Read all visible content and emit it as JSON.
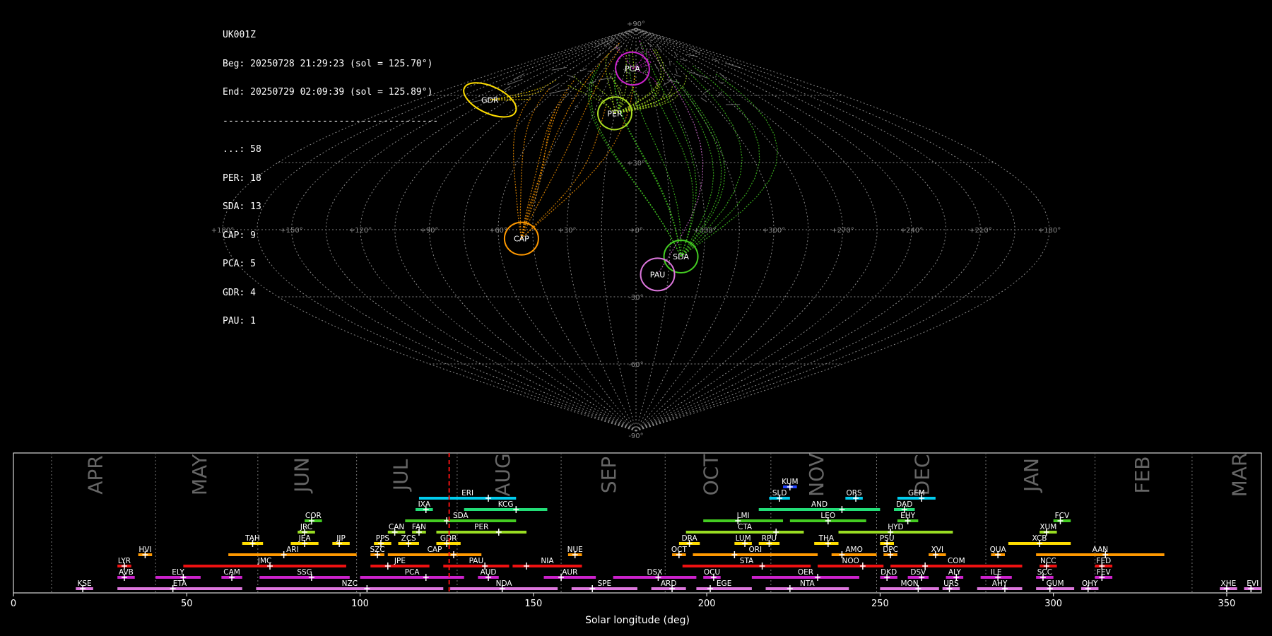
{
  "header": {
    "station": "UK001Z",
    "begin": "Beg: 20250728 21:29:23 (sol = 125.70°)",
    "end": "End: 20250729 02:09:39 (sol = 125.89°)",
    "separator": "---------------------------------------",
    "counts": [
      {
        "label": "...: 58"
      },
      {
        "label": "PER: 18"
      },
      {
        "label": "SDA: 13"
      },
      {
        "label": "CAP: 9"
      },
      {
        "label": "PCA: 5"
      },
      {
        "label": "GDR: 4"
      },
      {
        "label": "PAU: 1"
      }
    ]
  },
  "map": {
    "lon_ticks": [
      "+180°",
      "+150°",
      "+120°",
      "+90°",
      "+60°",
      "+30°",
      "+0°",
      "+330°",
      "+300°",
      "+270°",
      "+240°",
      "+210°",
      "+180°"
    ],
    "lat_ticks": [
      {
        "lat": 90,
        "label": "+90°"
      },
      {
        "lat": 30,
        "label": "+30°"
      },
      {
        "lat": -30,
        "label": "-30°"
      },
      {
        "lat": -60,
        "label": "-60°"
      },
      {
        "lat": -90,
        "label": "-90°"
      }
    ],
    "radiants": [
      {
        "code": "PCA",
        "x": -5,
        "y": 72,
        "color": "#cc22cc"
      },
      {
        "code": "PER",
        "x": -15,
        "y": 52,
        "color": "#aadd22"
      },
      {
        "code": "GDR",
        "x": -120,
        "y": 58,
        "color": "#ffdd00"
      },
      {
        "code": "CAP",
        "x": -50,
        "y": -4,
        "color": "#ff9900"
      },
      {
        "code": "SDA",
        "x": 20,
        "y": -12,
        "color": "#44cc22"
      },
      {
        "code": "PAU",
        "x": 10,
        "y": -20,
        "color": "#dd77dd"
      }
    ]
  },
  "chart_data": {
    "type": "timeline",
    "xlabel": "Solar longitude (deg)",
    "xlim": [
      0,
      360
    ],
    "xticks": [
      0,
      50,
      100,
      150,
      200,
      250,
      300,
      350
    ],
    "current_sol": 125.7,
    "months": [
      {
        "name": "APR",
        "start": 11,
        "label": 24
      },
      {
        "name": "MAY",
        "start": 41,
        "label": 54
      },
      {
        "name": "JUN",
        "start": 70.5,
        "label": 83.5
      },
      {
        "name": "JUL",
        "start": 99,
        "label": 112
      },
      {
        "name": "AUG",
        "start": 128,
        "label": 141.5
      },
      {
        "name": "SEP",
        "start": 158,
        "label": 172
      },
      {
        "name": "OCT",
        "start": 188,
        "label": 201.5
      },
      {
        "name": "NOV",
        "start": 218.5,
        "label": 232
      },
      {
        "name": "DEC",
        "start": 249,
        "label": 262.5
      },
      {
        "name": "JAN",
        "start": 280.5,
        "label": 294
      },
      {
        "name": "FEB",
        "start": 312,
        "label": 326
      },
      {
        "name": "MAR",
        "start": 340,
        "label": 354
      }
    ],
    "showers": [
      {
        "code": "KUM",
        "row": 10,
        "start": 222,
        "end": 226,
        "peak": 224,
        "color": "#2244ff"
      },
      {
        "code": "ERI",
        "row": 9,
        "start": 117,
        "end": 145,
        "peak": 137,
        "color": "#00ccee"
      },
      {
        "code": "SLD",
        "row": 9,
        "start": 218,
        "end": 224,
        "peak": 221,
        "color": "#00ccee"
      },
      {
        "code": "ORS",
        "row": 9,
        "start": 240,
        "end": 245,
        "peak": 243,
        "color": "#00ccee"
      },
      {
        "code": "GEM",
        "row": 9,
        "start": 255,
        "end": 266,
        "peak": 262,
        "color": "#00ccee"
      },
      {
        "code": "IXA",
        "row": 8,
        "start": 116,
        "end": 121,
        "peak": 119,
        "color": "#22dd77"
      },
      {
        "code": "KCG",
        "row": 8,
        "start": 130,
        "end": 154,
        "peak": 145,
        "color": "#22dd77"
      },
      {
        "code": "AND",
        "row": 8,
        "start": 215,
        "end": 250,
        "peak": 239,
        "color": "#22dd77"
      },
      {
        "code": "DAD",
        "row": 8,
        "start": 254,
        "end": 260,
        "peak": 257,
        "color": "#22dd77"
      },
      {
        "code": "COR",
        "row": 7,
        "start": 84,
        "end": 89,
        "peak": 86,
        "color": "#44cc22"
      },
      {
        "code": "SDA",
        "row": 7,
        "start": 113,
        "end": 145,
        "peak": 125,
        "color": "#44cc22"
      },
      {
        "code": "LMI",
        "row": 7,
        "start": 199,
        "end": 222,
        "peak": 209,
        "color": "#44cc22"
      },
      {
        "code": "LEO",
        "row": 7,
        "start": 224,
        "end": 246,
        "peak": 235,
        "color": "#44cc22"
      },
      {
        "code": "EHY",
        "row": 7,
        "start": 255,
        "end": 261,
        "peak": 258,
        "color": "#44cc22"
      },
      {
        "code": "FCV",
        "row": 7,
        "start": 300,
        "end": 305,
        "peak": 302,
        "color": "#44cc22"
      },
      {
        "code": "JRC",
        "row": 6,
        "start": 82,
        "end": 87,
        "peak": 84,
        "color": "#99dd22"
      },
      {
        "code": "CAN",
        "row": 6,
        "start": 108,
        "end": 113,
        "peak": 110,
        "color": "#99dd22"
      },
      {
        "code": "FAN",
        "row": 6,
        "start": 115,
        "end": 119,
        "peak": 117,
        "color": "#99dd22"
      },
      {
        "code": "PER",
        "row": 6,
        "start": 122,
        "end": 148,
        "peak": 140,
        "color": "#99dd22"
      },
      {
        "code": "CTA",
        "row": 6,
        "start": 194,
        "end": 228,
        "peak": 220,
        "color": "#99dd22"
      },
      {
        "code": "HYD",
        "row": 6,
        "start": 238,
        "end": 271,
        "peak": 253,
        "color": "#99dd22"
      },
      {
        "code": "XUM",
        "row": 6,
        "start": 296,
        "end": 301,
        "peak": 298,
        "color": "#99dd22"
      },
      {
        "code": "TAH",
        "row": 5,
        "start": 66,
        "end": 72,
        "peak": 69,
        "color": "#ffdd00"
      },
      {
        "code": "JEA",
        "row": 5,
        "start": 80,
        "end": 88,
        "peak": 84,
        "color": "#ffdd00"
      },
      {
        "code": "JIP",
        "row": 5,
        "start": 92,
        "end": 97,
        "peak": 94,
        "color": "#ffdd00"
      },
      {
        "code": "PPS",
        "row": 5,
        "start": 104,
        "end": 109,
        "peak": 106,
        "color": "#ffdd00"
      },
      {
        "code": "ZCS",
        "row": 5,
        "start": 111,
        "end": 117,
        "peak": 114,
        "color": "#ffdd00"
      },
      {
        "code": "GDR",
        "row": 5,
        "start": 122,
        "end": 129,
        "peak": 125,
        "color": "#ffdd00"
      },
      {
        "code": "DRA",
        "row": 5,
        "start": 192,
        "end": 198,
        "peak": 195,
        "color": "#ffdd00"
      },
      {
        "code": "LUM",
        "row": 5,
        "start": 208,
        "end": 213,
        "peak": 211,
        "color": "#ffdd00"
      },
      {
        "code": "RPU",
        "row": 5,
        "start": 215,
        "end": 221,
        "peak": 218,
        "color": "#ffdd00"
      },
      {
        "code": "THA",
        "row": 5,
        "start": 231,
        "end": 238,
        "peak": 235,
        "color": "#ffdd00"
      },
      {
        "code": "PSU",
        "row": 5,
        "start": 250,
        "end": 254,
        "peak": 252,
        "color": "#ffdd00"
      },
      {
        "code": "XCB",
        "row": 5,
        "start": 287,
        "end": 305,
        "peak": 296,
        "color": "#ffdd00"
      },
      {
        "code": "HVI",
        "row": 4,
        "start": 36,
        "end": 40,
        "peak": 38,
        "color": "#ff9900"
      },
      {
        "code": "ARI",
        "row": 4,
        "start": 62,
        "end": 99,
        "peak": 78,
        "color": "#ff9900"
      },
      {
        "code": "SZC",
        "row": 4,
        "start": 103,
        "end": 107,
        "peak": 105,
        "color": "#ff9900"
      },
      {
        "code": "CAP",
        "row": 4,
        "start": 108,
        "end": 135,
        "peak": 127,
        "color": "#ff9900"
      },
      {
        "code": "NUE",
        "row": 4,
        "start": 160,
        "end": 164,
        "peak": 162,
        "color": "#ff9900"
      },
      {
        "code": "OCT",
        "row": 4,
        "start": 190,
        "end": 194,
        "peak": 192,
        "color": "#ff9900"
      },
      {
        "code": "ORI",
        "row": 4,
        "start": 196,
        "end": 232,
        "peak": 208,
        "color": "#ff9900"
      },
      {
        "code": "AMO",
        "row": 4,
        "start": 236,
        "end": 249,
        "peak": 239,
        "color": "#ff9900"
      },
      {
        "code": "DPC",
        "row": 4,
        "start": 251,
        "end": 255,
        "peak": 253,
        "color": "#ff9900"
      },
      {
        "code": "XVI",
        "row": 4,
        "start": 264,
        "end": 269,
        "peak": 266,
        "color": "#ff9900"
      },
      {
        "code": "QUA",
        "row": 4,
        "start": 282,
        "end": 286,
        "peak": 284,
        "color": "#ff9900"
      },
      {
        "code": "AAN",
        "row": 4,
        "start": 295,
        "end": 332,
        "peak": 315,
        "color": "#ff9900"
      },
      {
        "code": "LYR",
        "row": 3,
        "start": 30,
        "end": 34,
        "peak": 32,
        "color": "#ee1111"
      },
      {
        "code": "JMC",
        "row": 3,
        "start": 49,
        "end": 96,
        "peak": 74,
        "color": "#ee1111"
      },
      {
        "code": "JPE",
        "row": 3,
        "start": 103,
        "end": 120,
        "peak": 108,
        "color": "#ee1111"
      },
      {
        "code": "PAU",
        "row": 3,
        "start": 124,
        "end": 143,
        "peak": 136,
        "color": "#ee1111"
      },
      {
        "code": "NIA",
        "row": 3,
        "start": 144,
        "end": 164,
        "peak": 148,
        "color": "#ee1111"
      },
      {
        "code": "STA",
        "row": 3,
        "start": 193,
        "end": 230,
        "peak": 216,
        "color": "#ee1111"
      },
      {
        "code": "NOO",
        "row": 3,
        "start": 232,
        "end": 251,
        "peak": 245,
        "color": "#ee1111"
      },
      {
        "code": "COM",
        "row": 3,
        "start": 253,
        "end": 291,
        "peak": 263,
        "color": "#ee1111"
      },
      {
        "code": "NCC",
        "row": 3,
        "start": 296,
        "end": 301,
        "peak": 298,
        "color": "#ee1111"
      },
      {
        "code": "FED",
        "row": 3,
        "start": 312,
        "end": 317,
        "peak": 314,
        "color": "#ee1111"
      },
      {
        "code": "AVB",
        "row": 2,
        "start": 30,
        "end": 35,
        "peak": 32,
        "color": "#cc22cc"
      },
      {
        "code": "ELY",
        "row": 2,
        "start": 41,
        "end": 54,
        "peak": 49,
        "color": "#cc22cc"
      },
      {
        "code": "CAM",
        "row": 2,
        "start": 60,
        "end": 66,
        "peak": 63,
        "color": "#cc22cc"
      },
      {
        "code": "SSG",
        "row": 2,
        "start": 71,
        "end": 97,
        "peak": 86,
        "color": "#cc22cc"
      },
      {
        "code": "PCA",
        "row": 2,
        "start": 100,
        "end": 130,
        "peak": 119,
        "color": "#cc22cc"
      },
      {
        "code": "AUD",
        "row": 2,
        "start": 134,
        "end": 140,
        "peak": 137,
        "color": "#cc22cc"
      },
      {
        "code": "AUR",
        "row": 2,
        "start": 153,
        "end": 168,
        "peak": 158,
        "color": "#cc22cc"
      },
      {
        "code": "DSX",
        "row": 2,
        "start": 173,
        "end": 197,
        "peak": 186,
        "color": "#cc22cc"
      },
      {
        "code": "OCU",
        "row": 2,
        "start": 199,
        "end": 204,
        "peak": 202,
        "color": "#cc22cc"
      },
      {
        "code": "OER",
        "row": 2,
        "start": 213,
        "end": 244,
        "peak": 232,
        "color": "#cc22cc"
      },
      {
        "code": "DKD",
        "row": 2,
        "start": 250,
        "end": 255,
        "peak": 252,
        "color": "#cc22cc"
      },
      {
        "code": "DSV",
        "row": 2,
        "start": 258,
        "end": 264,
        "peak": 262,
        "color": "#cc22cc"
      },
      {
        "code": "ALY",
        "row": 2,
        "start": 269,
        "end": 274,
        "peak": 272,
        "color": "#cc22cc"
      },
      {
        "code": "ILE",
        "row": 2,
        "start": 279,
        "end": 288,
        "peak": 284,
        "color": "#cc22cc"
      },
      {
        "code": "SCC",
        "row": 2,
        "start": 295,
        "end": 300,
        "peak": 297,
        "color": "#cc22cc"
      },
      {
        "code": "FEV",
        "row": 2,
        "start": 312,
        "end": 317,
        "peak": 314,
        "color": "#cc22cc"
      },
      {
        "code": "KSE",
        "row": 1,
        "start": 18,
        "end": 23,
        "peak": 20,
        "color": "#dd77dd"
      },
      {
        "code": "ETA",
        "row": 1,
        "start": 30,
        "end": 66,
        "peak": 46,
        "color": "#dd77dd"
      },
      {
        "code": "NZC",
        "row": 1,
        "start": 70,
        "end": 124,
        "peak": 102,
        "color": "#dd77dd"
      },
      {
        "code": "NDA",
        "row": 1,
        "start": 126,
        "end": 157,
        "peak": 141,
        "color": "#dd77dd"
      },
      {
        "code": "SPE",
        "row": 1,
        "start": 161,
        "end": 180,
        "peak": 167,
        "color": "#dd77dd"
      },
      {
        "code": "ARD",
        "row": 1,
        "start": 184,
        "end": 194,
        "peak": 190,
        "color": "#dd77dd"
      },
      {
        "code": "EGE",
        "row": 1,
        "start": 197,
        "end": 213,
        "peak": 201,
        "color": "#dd77dd"
      },
      {
        "code": "NTA",
        "row": 1,
        "start": 217,
        "end": 241,
        "peak": 224,
        "color": "#dd77dd"
      },
      {
        "code": "MON",
        "row": 1,
        "start": 250,
        "end": 267,
        "peak": 261,
        "color": "#dd77dd"
      },
      {
        "code": "URS",
        "row": 1,
        "start": 268,
        "end": 273,
        "peak": 270,
        "color": "#dd77dd"
      },
      {
        "code": "AHY",
        "row": 1,
        "start": 278,
        "end": 291,
        "peak": 286,
        "color": "#dd77dd"
      },
      {
        "code": "GUM",
        "row": 1,
        "start": 295,
        "end": 306,
        "peak": 299,
        "color": "#dd77dd"
      },
      {
        "code": "OHY",
        "row": 1,
        "start": 308,
        "end": 313,
        "peak": 310,
        "color": "#dd77dd"
      },
      {
        "code": "XHE",
        "row": 1,
        "start": 348,
        "end": 353,
        "peak": 350,
        "color": "#dd77dd"
      },
      {
        "code": "EVI",
        "row": 1,
        "start": 355,
        "end": 360,
        "peak": 357,
        "color": "#dd77dd"
      }
    ]
  }
}
